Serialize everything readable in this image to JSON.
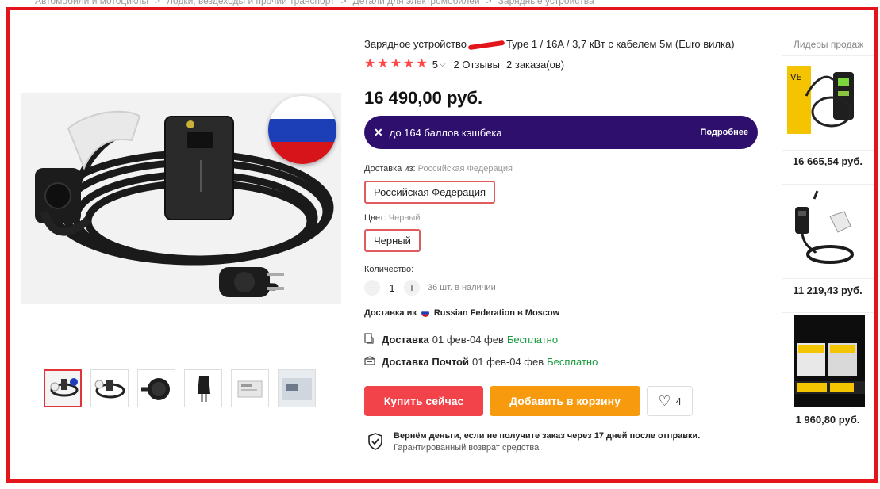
{
  "breadcrumb": {
    "items": [
      "Автомобили и мотоциклы",
      "Лодки, вездеходы и прочий транспорт",
      "Детали для электромобилей",
      "Зарядные устройства"
    ],
    "separator": ">"
  },
  "product": {
    "title_part1": "Зарядное устройство",
    "title_part2": "Type 1 / 16A / 3,7 кВт с кабелем 5м (Euro вилка)",
    "rating": "5",
    "reviews": "2 Отзывы",
    "orders": "2 заказа(ов)",
    "price": "16 490,00 руб."
  },
  "cashback": {
    "icon": "cashback-icon",
    "text": "до 164 баллов кэшбека",
    "more": "Подробнее",
    "color": "#2e0f6e"
  },
  "options": {
    "ship_from_label": "Доставка из:",
    "ship_from_value": "Российская Федерация",
    "ship_from_selected": "Российская Федерация",
    "color_label": "Цвет:",
    "color_value": "Черный",
    "color_selected": "Черный"
  },
  "quantity": {
    "label": "Количество:",
    "minus": "−",
    "value": "1",
    "plus": "+",
    "stock": "36 шт. в наличии"
  },
  "shipping": {
    "from_prefix": "Доставка из",
    "from_text": "Russian Federation в Moscow",
    "options": [
      {
        "name": "Доставка",
        "dates": "01 фев-04 фев",
        "cost": "Бесплатно"
      },
      {
        "name": "Доставка Почтой",
        "dates": "01 фев-04 фев",
        "cost": "Бесплатно"
      }
    ]
  },
  "actions": {
    "buy_now": "Купить сейчас",
    "add_to_cart": "Добавить в корзину",
    "wishlist_count": "4",
    "buy_color": "#f2434a",
    "cart_color": "#f89a0e"
  },
  "guarantee": {
    "title": "Вернём деньги, если не получите заказ через 17 дней после отправки.",
    "subtitle": "Гарантированный возврат средства"
  },
  "bestsellers": {
    "title": "Лидеры продаж",
    "items": [
      {
        "price": "16 665,54 руб."
      },
      {
        "price": "11 219,43 руб."
      },
      {
        "price": "1 960,80 руб."
      }
    ]
  },
  "colors": {
    "frame": "#e4141b",
    "accent_red": "#ff4747",
    "free_green": "#1a9b3e"
  }
}
